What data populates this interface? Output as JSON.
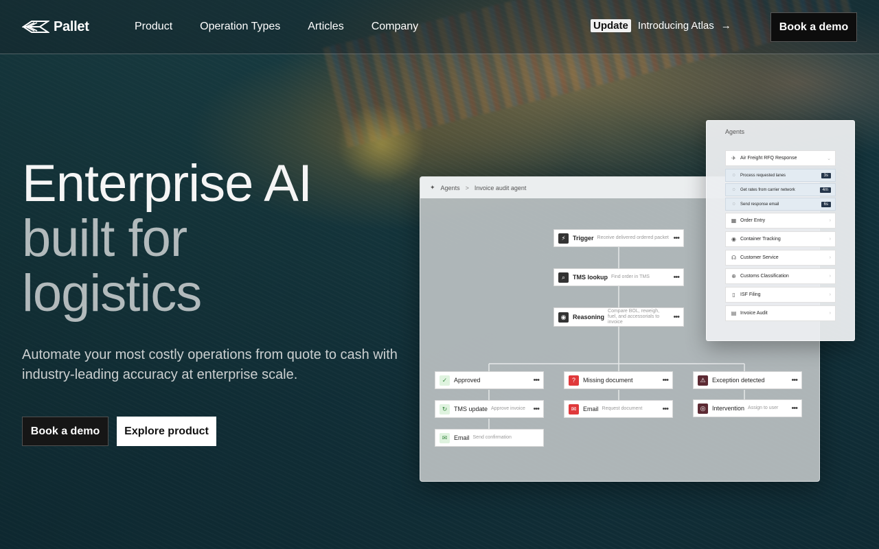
{
  "nav": {
    "logo_text": "Pallet",
    "links": [
      "Product",
      "Operation Types",
      "Articles",
      "Company"
    ],
    "announcement": {
      "badge": "Update",
      "text": "Introducing Atlas",
      "arrow": "→"
    },
    "cta": "Book a demo"
  },
  "hero": {
    "title_lines": [
      "Enterprise AI",
      "built for",
      "logistics"
    ],
    "subtitle": "Automate your most costly operations from quote to cash with industry-leading accuracy at enterprise scale.",
    "primary_cta": "Book a demo",
    "secondary_cta": "Explore product"
  },
  "workflow": {
    "breadcrumb": {
      "root": "Agents",
      "sep": ">",
      "current": "Invoice audit agent"
    },
    "nodes": {
      "trigger": {
        "title": "Trigger",
        "desc": "Receive delivered ordered packet",
        "icon": "bolt-icon"
      },
      "tms_lookup": {
        "title": "TMS lookup",
        "desc": "Find order in TMS",
        "icon": "search-icon"
      },
      "reasoning": {
        "title": "Reasoning",
        "desc": "Compare BOL, reweigh, fuel, and accessorials to invoice",
        "icon": "brain-icon"
      },
      "approved": {
        "title": "Approved",
        "desc": "",
        "icon": "check-icon"
      },
      "tms_update": {
        "title": "TMS update",
        "desc": "Approve invoice",
        "icon": "refresh-icon"
      },
      "email_confirm": {
        "title": "Email",
        "desc": "Send confirmation",
        "icon": "mail-icon"
      },
      "missing_doc": {
        "title": "Missing document",
        "desc": "",
        "icon": "question-icon"
      },
      "email_request": {
        "title": "Email",
        "desc": "Request document",
        "icon": "mail-icon"
      },
      "exception": {
        "title": "Exception detected",
        "desc": "",
        "icon": "warning-icon"
      },
      "intervention": {
        "title": "Intervention",
        "desc": "Assign to user",
        "icon": "user-icon"
      }
    },
    "dots": "•••"
  },
  "agents": {
    "title": "Agents",
    "featured": {
      "label": "Air Freight RFQ Response",
      "icon": "plane-icon"
    },
    "steps": [
      {
        "label": "Process requested lanes",
        "time": "3s"
      },
      {
        "label": "Get rates from carrier network",
        "time": "4m"
      },
      {
        "label": "Send response email",
        "time": "6s"
      }
    ],
    "items": [
      {
        "label": "Order Entry",
        "icon": "calendar-icon"
      },
      {
        "label": "Container Tracking",
        "icon": "pin-icon"
      },
      {
        "label": "Customer Service",
        "icon": "headset-icon"
      },
      {
        "label": "Customs Classification",
        "icon": "globe-icon"
      },
      {
        "label": "ISF Filing",
        "icon": "file-icon"
      },
      {
        "label": "Invoice Audit",
        "icon": "document-icon"
      }
    ]
  }
}
